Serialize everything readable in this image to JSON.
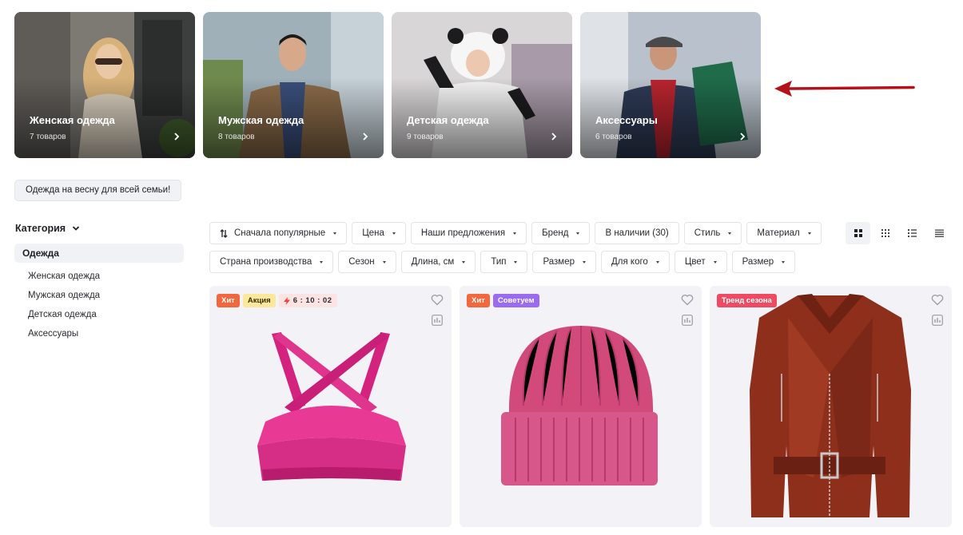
{
  "categories": [
    {
      "title": "Женская одежда",
      "count": "7 товаров"
    },
    {
      "title": "Мужская одежда",
      "count": "8 товаров"
    },
    {
      "title": "Детская одежда",
      "count": "9 товаров"
    },
    {
      "title": "Аксессуары",
      "count": "6 товаров"
    }
  ],
  "promo_label": "Одежда на весну для всей семьи!",
  "sidebar": {
    "heading": "Категория",
    "active": "Одежда",
    "items": [
      "Женская одежда",
      "Мужская одежда",
      "Детская одежда",
      "Аксессуары"
    ]
  },
  "filters": {
    "sort": "Сначала популярные",
    "row1": [
      "Цена",
      "Наши предложения",
      "Бренд"
    ],
    "in_stock": "В наличии (30)",
    "row1b": [
      "Стиль",
      "Материал"
    ],
    "row2": [
      "Страна производства",
      "Сезон",
      "Длина, см",
      "Тип",
      "Размер",
      "Для кого",
      "Цвет",
      "Размер"
    ]
  },
  "products": [
    {
      "badges": [
        "Хит",
        "Акция"
      ],
      "timer": "6 : 10 : 02",
      "image": "pink-sports-bra"
    },
    {
      "badges": [
        "Хит",
        "Советуем"
      ],
      "image": "pink-knit-beanie"
    },
    {
      "badges": [
        "Тренд сезона"
      ],
      "image": "brown-leather-jacket"
    }
  ],
  "colors": {
    "accent_arrow": "#b3121a",
    "hit": "#f2673b",
    "advise": "#9a6af0",
    "trend": "#ee4b63"
  }
}
